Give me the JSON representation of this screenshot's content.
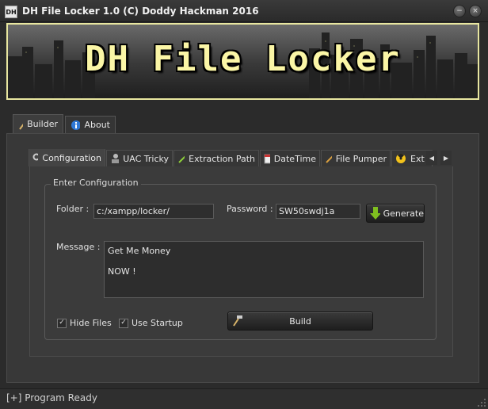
{
  "window": {
    "title": "DH File Locker 1.0 (C) Doddy Hackman 2016",
    "icon_text": "DH",
    "minimize_symbol": "−",
    "close_symbol": "×"
  },
  "banner": {
    "title": "DH File Locker"
  },
  "outer_tabs": [
    {
      "label": "Builder",
      "icon": "hammer-icon",
      "active": true
    },
    {
      "label": "About",
      "icon": "info-icon",
      "active": false
    }
  ],
  "inner_tabs": [
    {
      "label": "Configuration",
      "icon": "gears-icon",
      "active": true
    },
    {
      "label": "UAC Tricky",
      "icon": "admin-icon",
      "active": false
    },
    {
      "label": "Extraction Path",
      "icon": "wand-icon",
      "active": false
    },
    {
      "label": "DateTime",
      "icon": "calendar-icon",
      "active": false
    },
    {
      "label": "File Pumper",
      "icon": "sparkle-icon",
      "active": false
    },
    {
      "label": "Ext",
      "icon": "radiation-icon",
      "active": false
    }
  ],
  "tab_scroll": {
    "left": "◀",
    "right": "▶"
  },
  "config": {
    "group_title": "Enter Configuration",
    "folder_label": "Folder :",
    "folder_value": "c:/xampp/locker/",
    "password_label": "Password :",
    "password_value": "SW50swdj1a",
    "generate_label": "Generate",
    "message_label": "Message :",
    "message_line1": "Get Me Money",
    "message_line2": "NOW !",
    "hide_files_label": "Hide Files",
    "hide_files_checked": true,
    "use_startup_label": "Use Startup",
    "use_startup_checked": true,
    "build_label": "Build",
    "check_mark": "✓"
  },
  "status": {
    "text": "[+] Program Ready"
  },
  "colors": {
    "banner_text": "#fbf6a6",
    "accent_green": "#7fbf1f",
    "background": "#2b2b2b"
  }
}
